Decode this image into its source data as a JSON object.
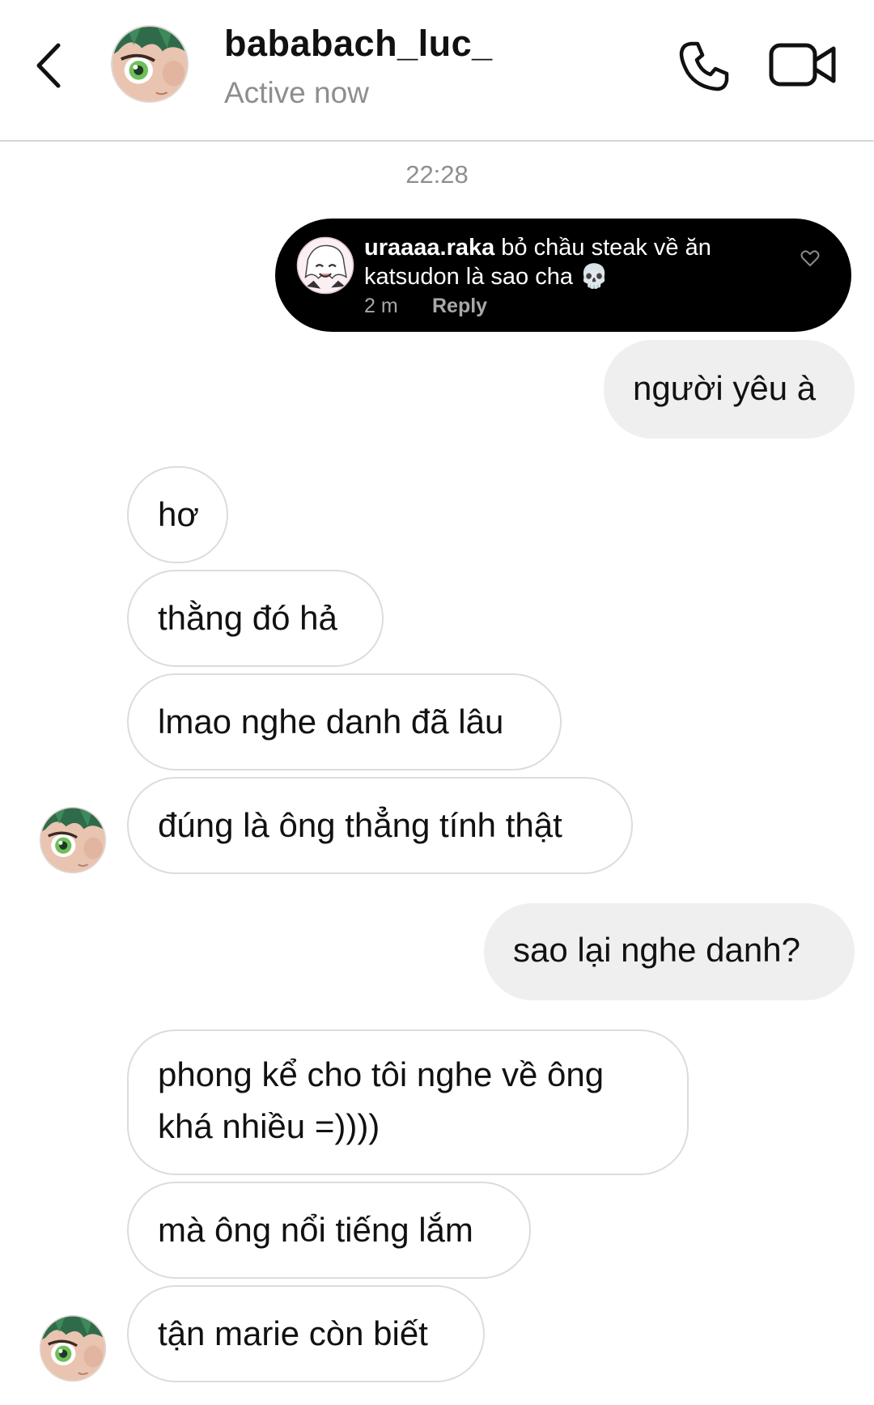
{
  "header": {
    "username": "bababach_luc_",
    "status": "Active now",
    "icons": {
      "back": "chevron-left-icon",
      "call": "phone-icon",
      "video": "video-camera-icon"
    }
  },
  "thread": {
    "timestamp": "22:28",
    "story_notification": {
      "username": "uraaaa.raka",
      "text": " bỏ chầu steak về ăn katsudon là sao cha 💀",
      "time": "2 m",
      "reply_label": "Reply",
      "icon": "heart-icon"
    },
    "messages": [
      {
        "side": "sent",
        "text": "người yêu à"
      },
      {
        "side": "received",
        "text": "hơ"
      },
      {
        "side": "received",
        "text": "thằng đó hả"
      },
      {
        "side": "received",
        "text": "lmao nghe danh đã lâu"
      },
      {
        "side": "received",
        "text": "đúng là ông thẳng tính thật"
      },
      {
        "side": "sent",
        "text": "sao lại nghe danh?"
      },
      {
        "side": "received",
        "text": "phong kể cho tôi nghe về ông khá nhiều =))))"
      },
      {
        "side": "received",
        "text": "mà ông nổi tiếng lắm"
      },
      {
        "side": "received",
        "text": "tận marie còn biết"
      }
    ]
  },
  "colors": {
    "sent_bubble": "#efefef",
    "received_border": "#dcdcdc",
    "notification_bg": "#000000",
    "muted_text": "#8e8e8e"
  }
}
